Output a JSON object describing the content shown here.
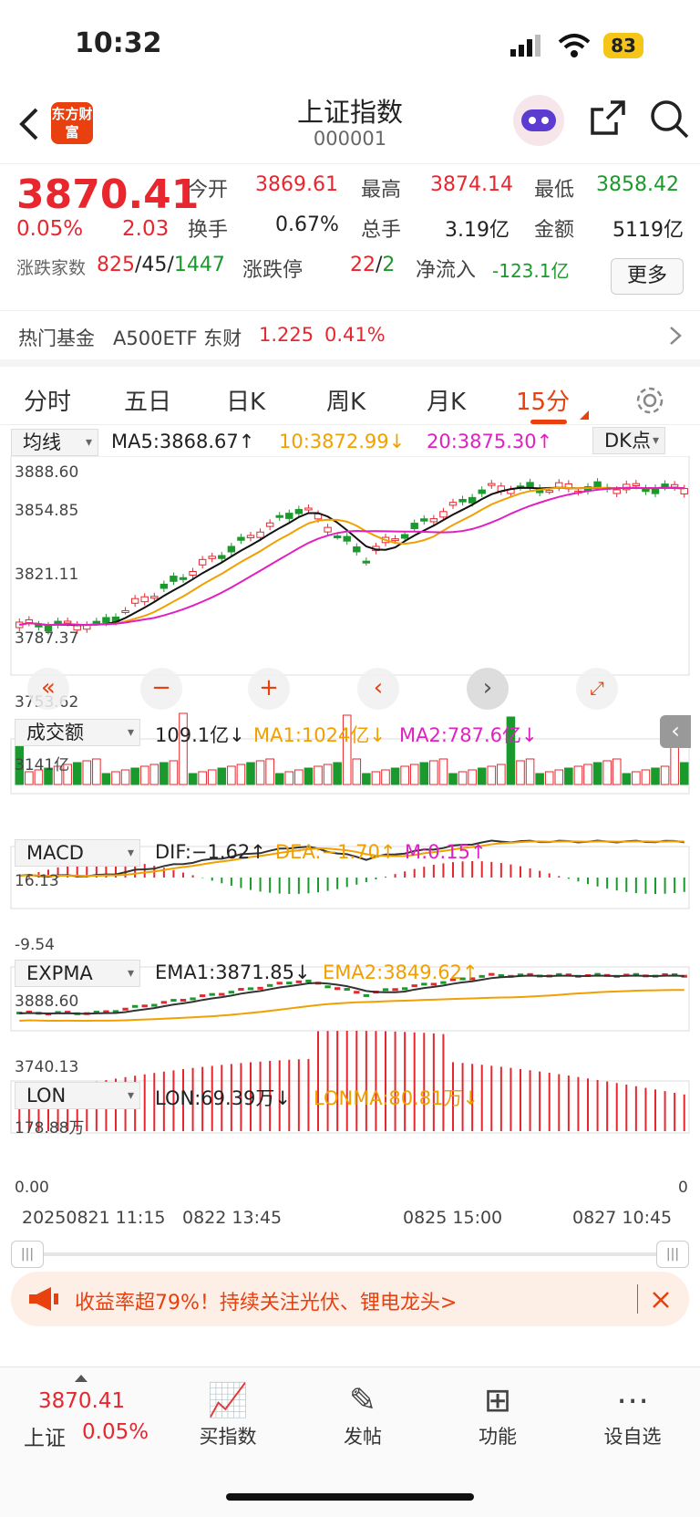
{
  "status": {
    "time": "10:32",
    "battery": "83"
  },
  "header": {
    "logo": "东方财富",
    "title": "上证指数",
    "code": "000001"
  },
  "quote": {
    "price": "3870.41",
    "pct": "0.05%",
    "chg": "2.03",
    "open_l": "今开",
    "open_v": "3869.61",
    "high_l": "最高",
    "high_v": "3874.14",
    "low_l": "最低",
    "low_v": "3858.42",
    "turn_l": "换手",
    "turn_v": "0.67%",
    "vol_l": "总手",
    "vol_v": "3.19亿",
    "amt_l": "金额",
    "amt_v": "5119亿",
    "adv_l": "涨跌家数",
    "adv_up": "825",
    "adv_flat": "45",
    "adv_down": "1447",
    "limit_l": "涨跌停",
    "limit_up": "22",
    "limit_down": "2",
    "flow_l": "净流入",
    "flow_v": "-123.1亿",
    "more": "更多"
  },
  "fund": {
    "label": "热门基金",
    "name": "A500ETF 东财",
    "price": "1.225",
    "pct": "0.41%"
  },
  "tabs": [
    "分时",
    "五日",
    "日K",
    "周K",
    "月K",
    "15分"
  ],
  "ma": {
    "select": "均线",
    "ma5": "MA5:3868.67↑",
    "ma10": "10:3872.99↓",
    "ma20": "20:3875.30↑",
    "dk": "DK点"
  },
  "price_axis": [
    "3888.60",
    "3854.85",
    "3821.11",
    "3787.37",
    "3753.62"
  ],
  "vol": {
    "select": "成交额",
    "v": "109.1亿↓",
    "ma1": "MA1:1024亿↓",
    "ma2": "MA2:787.6亿↓",
    "axis": "3141亿"
  },
  "macd": {
    "select": "MACD",
    "dif": "DIF:−1.62↑",
    "dea": "DEA:−1.70↑",
    "m": "M:0.15↑",
    "top": "16.13",
    "bot": "-9.54"
  },
  "expma": {
    "select": "EXPMA",
    "e1": "EMA1:3871.85↓",
    "e2": "EMA2:3849.62↑",
    "top": "3888.60",
    "bot": "3740.13"
  },
  "lon": {
    "select": "LON",
    "lon": "LON:69.39万↓",
    "lonma": "LONMA:80.81万↓",
    "top": "178.88万",
    "bot": "0.00",
    "right": "0"
  },
  "dates": [
    "20250821 11:15",
    "0822 13:45",
    "0825 15:00",
    "0827 10:45"
  ],
  "banner": "收益率超79%！持续关注光伏、锂电龙头>",
  "bottom": {
    "price": "3870.41",
    "name": "上证",
    "pct": "0.05%",
    "items": [
      "买指数",
      "发帖",
      "功能",
      "设自选"
    ]
  },
  "colors": {
    "up": "#e8262e",
    "down": "#1a9a2c",
    "ma10": "#f0a000",
    "ma20": "#e020c0"
  }
}
